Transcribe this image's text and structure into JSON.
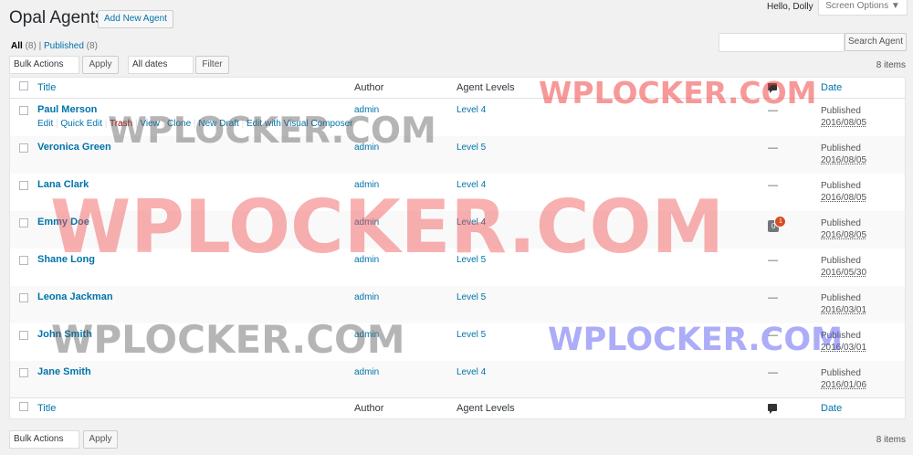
{
  "header": {
    "page_title": "Opal Agents",
    "add_new_label": "Add New Agent",
    "greeting": "Hello, Dolly",
    "screen_options": "Screen Options ▼"
  },
  "filters": {
    "all_label": "All",
    "all_count": "(8)",
    "separator": "|",
    "published_label": "Published",
    "published_count": "(8)"
  },
  "search": {
    "value": "",
    "button_label": "Search Agent"
  },
  "top_nav": {
    "bulk_actions": "Bulk Actions",
    "apply": "Apply",
    "dates": "All dates",
    "filter": "Filter",
    "items_count": "8 items"
  },
  "bottom_nav": {
    "bulk_actions": "Bulk Actions",
    "apply": "Apply",
    "items_count": "8 items"
  },
  "columns": {
    "title": "Title",
    "author": "Author",
    "levels": "Agent Levels",
    "date": "Date"
  },
  "row_actions": {
    "edit": "Edit",
    "quick_edit": "Quick Edit",
    "trash": "Trash",
    "view": "View",
    "clone": "Clone",
    "new_draft": "New Draft",
    "edit_vc": "Edit with Visual Composer",
    "sep": "|"
  },
  "rows": [
    {
      "title": "Paul Merson",
      "author": "admin",
      "level": "Level 4",
      "comments": "—",
      "status": "Published",
      "date": "2016/08/05"
    },
    {
      "title": "Veronica Green",
      "author": "admin",
      "level": "Level 5",
      "comments": "—",
      "status": "Published",
      "date": "2016/08/05"
    },
    {
      "title": "Lana Clark",
      "author": "admin",
      "level": "Level 4",
      "comments": "—",
      "status": "Published",
      "date": "2016/08/05"
    },
    {
      "title": "Emmy Doe",
      "author": "admin",
      "level": "Level 4",
      "comments": "0",
      "pending": "1",
      "status": "Published",
      "date": "2016/08/05"
    },
    {
      "title": "Shane Long",
      "author": "admin",
      "level": "Level 5",
      "comments": "—",
      "status": "Published",
      "date": "2016/05/30"
    },
    {
      "title": "Leona Jackman",
      "author": "admin",
      "level": "Level 5",
      "comments": "—",
      "status": "Published",
      "date": "2016/03/01"
    },
    {
      "title": "John Smith",
      "author": "admin",
      "level": "Level 5",
      "comments": "—",
      "status": "Published",
      "date": "2016/03/01"
    },
    {
      "title": "Jane Smith",
      "author": "admin",
      "level": "Level 4",
      "comments": "—",
      "status": "Published",
      "date": "2016/01/06"
    }
  ],
  "watermarks": {
    "text_1": "WPLOCKER.COM",
    "text_2": "WPLOCKER.COM",
    "text_3": "WPLOCKER.COM",
    "text_4": "WPLOCKER.COM",
    "text_5": "WPLOCKER.COM"
  },
  "colors": {
    "link": "#0073aa",
    "trash": "#aa0000",
    "pending_badge": "#d54e21"
  }
}
